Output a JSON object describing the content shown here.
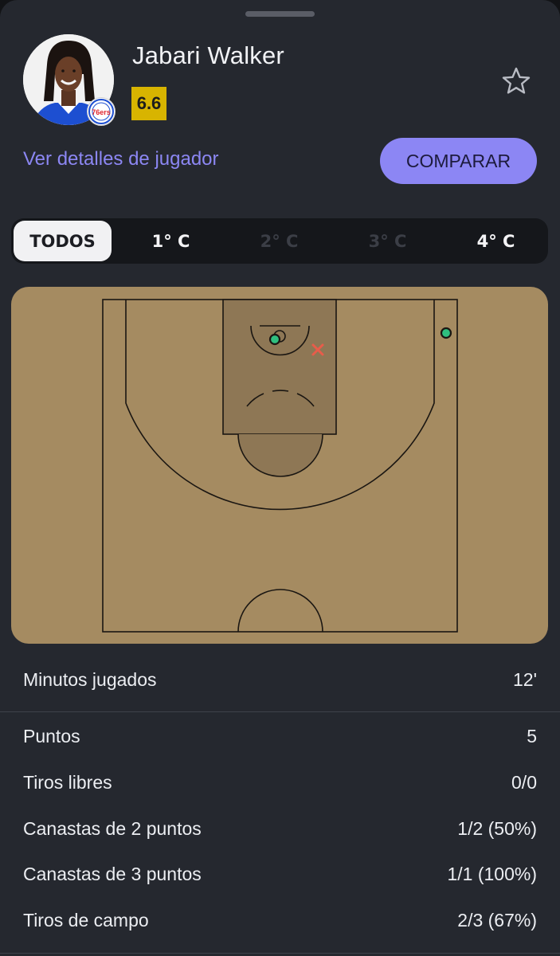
{
  "player": {
    "name": "Jabari Walker",
    "rating": "6.6",
    "team_logo_text": "76ers",
    "details_link": "Ver detalles de jugador",
    "compare_label": "COMPARAR"
  },
  "tabs": [
    {
      "label": "TODOS",
      "state": "active"
    },
    {
      "label": "1° C",
      "state": "enabled"
    },
    {
      "label": "2° C",
      "state": "disabled"
    },
    {
      "label": "3° C",
      "state": "disabled"
    },
    {
      "label": "4° C",
      "state": "enabled"
    }
  ],
  "shot_chart": {
    "shots": [
      {
        "result": "made",
        "color": "#2fbf7f",
        "description": "near basket"
      },
      {
        "result": "made",
        "color": "#2fbf7f",
        "description": "right corner three"
      },
      {
        "result": "missed",
        "color": "#e85c4a",
        "description": "short right of basket"
      }
    ]
  },
  "stats": {
    "minutes": {
      "label": "Minutos jugados",
      "value": "12'"
    },
    "rows": [
      {
        "label": "Puntos",
        "value": "5"
      },
      {
        "label": "Tiros libres",
        "value": "0/0"
      },
      {
        "label": "Canastas de 2 puntos",
        "value": "1/2 (50%)"
      },
      {
        "label": "Canastas de 3 puntos",
        "value": "1/1 (100%)"
      },
      {
        "label": "Tiros de campo",
        "value": "2/3 (67%)"
      }
    ]
  },
  "colors": {
    "accent": "#8c86f4",
    "rating_badge": "#d8b400",
    "court": "#a58b61",
    "made_shot": "#2fbf7f",
    "missed_shot": "#e85c4a"
  }
}
